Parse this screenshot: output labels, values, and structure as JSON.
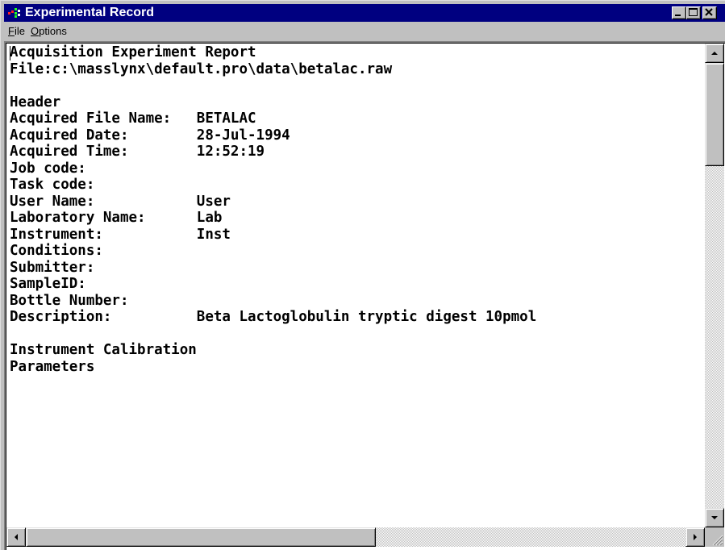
{
  "window": {
    "title": "Experimental Record",
    "title_bar_color": "#000080",
    "controls": [
      "minimize-icon",
      "maximize-icon",
      "close-icon"
    ]
  },
  "menu": {
    "file": {
      "accel": "F",
      "rest": "ile"
    },
    "options": {
      "accel": "O",
      "rest": "ptions"
    }
  },
  "report": {
    "lines": [
      "Acquisition Experiment Report",
      "File:c:\\masslynx\\default.pro\\data\\betalac.raw",
      "",
      "Header",
      "Acquired File Name:   BETALAC",
      "Acquired Date:        28-Jul-1994",
      "Acquired Time:        12:52:19",
      "Job code:",
      "Task code:",
      "User Name:            User",
      "Laboratory Name:      Lab",
      "Instrument:           Inst",
      "Conditions:",
      "Submitter:",
      "SampleID:",
      "Bottle Number:",
      "Description:          Beta Lactoglobulin tryptic digest 10pmol",
      "",
      "Instrument Calibration",
      "Parameters"
    ]
  },
  "icons": {
    "app": "experimental-record-app-icon",
    "scroll_up": "scroll-up-arrow-icon",
    "scroll_down": "scroll-down-arrow-icon",
    "scroll_left": "scroll-left-arrow-icon",
    "scroll_right": "scroll-right-arrow-icon",
    "size_grip": "size-grip-icon"
  }
}
